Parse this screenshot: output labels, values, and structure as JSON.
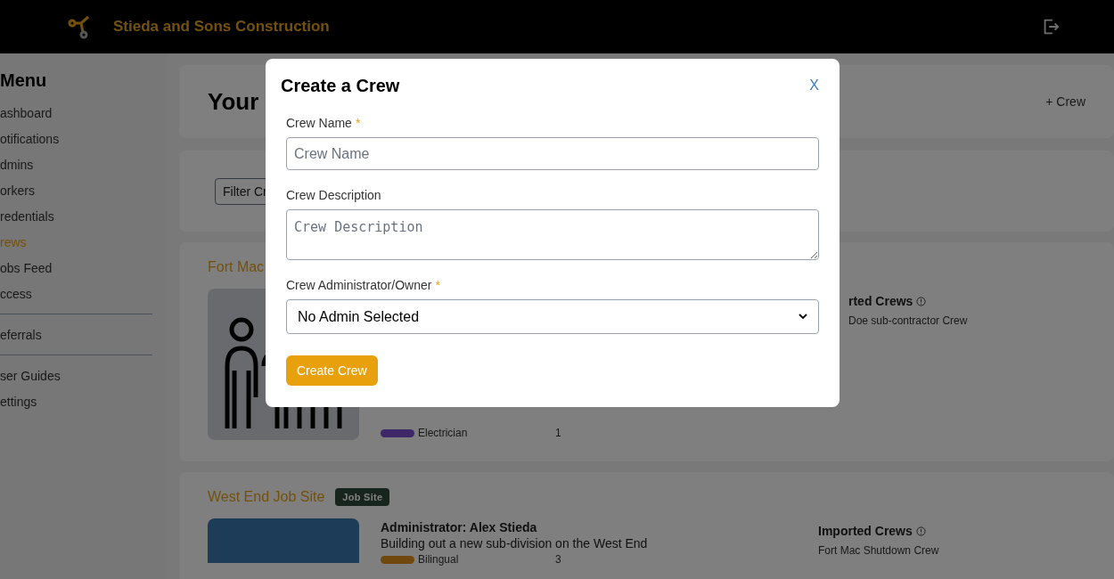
{
  "header": {
    "company": "Stieda and Sons Construction"
  },
  "sidebar": {
    "title": "Menu",
    "groups": [
      [
        {
          "label": "ashboard",
          "selected": false
        },
        {
          "label": "otifications",
          "selected": false
        },
        {
          "label": "dmins",
          "selected": false
        },
        {
          "label": "orkers",
          "selected": false
        },
        {
          "label": "redentials",
          "selected": false
        },
        {
          "label": "rews",
          "selected": true
        },
        {
          "label": "obs Feed",
          "selected": false
        },
        {
          "label": "ccess",
          "selected": false
        }
      ],
      [
        {
          "label": "eferrals",
          "selected": false
        }
      ],
      [
        {
          "label": "ser Guides",
          "selected": false
        },
        {
          "label": "ettings",
          "selected": false
        }
      ]
    ]
  },
  "page": {
    "title": "Your",
    "add_button": "+ Crew",
    "filter": "Filter Cr"
  },
  "crews": [
    {
      "name": "Fort Mac",
      "roles": [
        {
          "name": "Electrician",
          "count": "1",
          "color": "#3d2768"
        }
      ],
      "imported_title": "rted Crews",
      "imported": [
        "Doe sub-contractor Crew"
      ]
    },
    {
      "name": "West End Job Site",
      "badge": "Job Site",
      "administrator": "Administrator: Alex Stieda",
      "description": "Building out a new sub-division on the West End",
      "roles": [
        {
          "name": "Bilingual",
          "count": "3",
          "color": "#70480d"
        }
      ],
      "imported_title": "Imported Crews",
      "imported": [
        "Fort Mac Shutdown Crew"
      ]
    }
  ],
  "modal": {
    "title": "Create a Crew",
    "close": "X",
    "fields": [
      {
        "kind": "input",
        "label": "Crew Name",
        "required_mark": "*",
        "placeholder": "Crew Name"
      },
      {
        "kind": "textarea",
        "label": "Crew Description",
        "placeholder": "Crew Description"
      },
      {
        "kind": "select",
        "label": "Crew Administrator/Owner",
        "required_mark": "*",
        "value": "No Admin Selected"
      }
    ],
    "submit": "Create Crew"
  }
}
